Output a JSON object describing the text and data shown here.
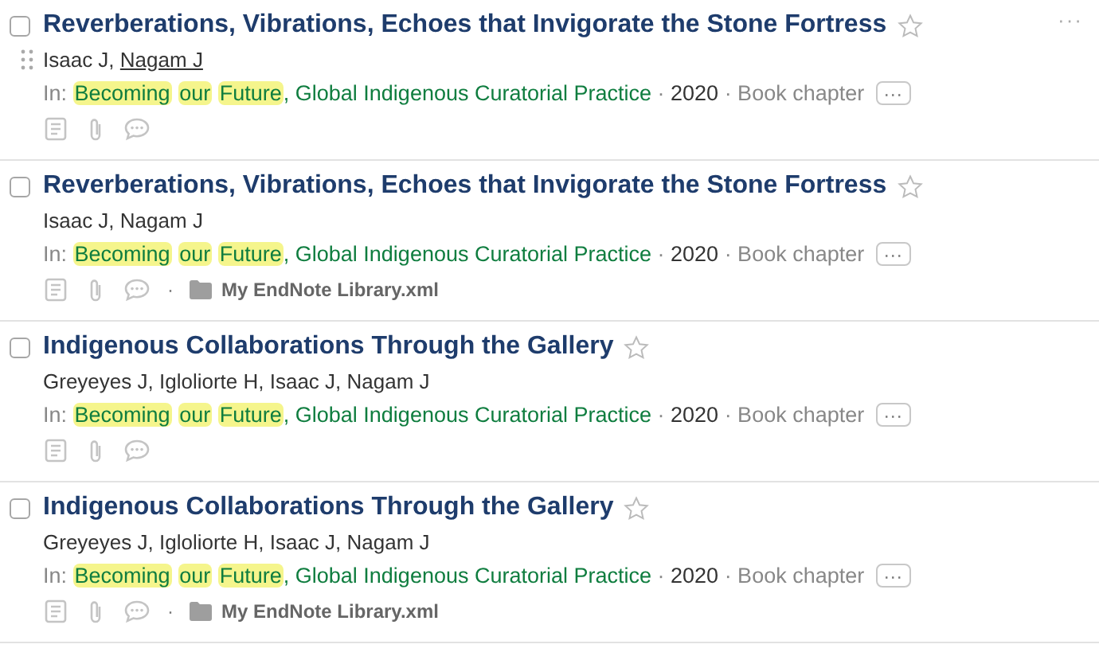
{
  "references": [
    {
      "title": "Reverberations, Vibrations, Echoes that Invigorate the Stone Fortress",
      "hovered": true,
      "checked": false,
      "starred": false,
      "authors": [
        {
          "name": "Isaac J,",
          "underlined": false
        },
        {
          "name": "Nagam J",
          "underlined": true
        }
      ],
      "prefix": "In:",
      "source": [
        {
          "text": "Becoming",
          "highlight": true
        },
        {
          "text": "our",
          "highlight": true
        },
        {
          "text": "Future",
          "highlight": true
        },
        {
          "text": ", Global Indigenous Curatorial Practice",
          "highlight": false
        }
      ],
      "dot": "·",
      "year": "2020",
      "type": "Book chapter",
      "more_label": "···",
      "row_menu": "···"
    },
    {
      "title": "Reverberations, Vibrations, Echoes that Invigorate the Stone Fortress",
      "hovered": false,
      "checked": false,
      "starred": false,
      "authors": [
        {
          "name": "Isaac J,",
          "underlined": false
        },
        {
          "name": "Nagam J",
          "underlined": false
        }
      ],
      "prefix": "In:",
      "source": [
        {
          "text": "Becoming",
          "highlight": true
        },
        {
          "text": "our",
          "highlight": true
        },
        {
          "text": "Future",
          "highlight": true
        },
        {
          "text": ", Global Indigenous Curatorial Practice",
          "highlight": false
        }
      ],
      "dot": "·",
      "year": "2020",
      "type": "Book chapter",
      "more_label": "···",
      "library": "My EndNote Library.xml"
    },
    {
      "title": "Indigenous Collaborations Through the Gallery",
      "hovered": false,
      "checked": false,
      "starred": false,
      "authors": [
        {
          "name": "Greyeyes J,",
          "underlined": false
        },
        {
          "name": "Igloliorte H,",
          "underlined": false
        },
        {
          "name": "Isaac J,",
          "underlined": false
        },
        {
          "name": "Nagam J",
          "underlined": false
        }
      ],
      "prefix": "In:",
      "source": [
        {
          "text": "Becoming",
          "highlight": true
        },
        {
          "text": "our",
          "highlight": true
        },
        {
          "text": "Future",
          "highlight": true
        },
        {
          "text": ", Global Indigenous Curatorial Practice",
          "highlight": false
        }
      ],
      "dot": "·",
      "year": "2020",
      "type": "Book chapter",
      "more_label": "···"
    },
    {
      "title": "Indigenous Collaborations Through the Gallery",
      "hovered": false,
      "checked": false,
      "starred": false,
      "authors": [
        {
          "name": "Greyeyes J,",
          "underlined": false
        },
        {
          "name": "Igloliorte H,",
          "underlined": false
        },
        {
          "name": "Isaac J,",
          "underlined": false
        },
        {
          "name": "Nagam J",
          "underlined": false
        }
      ],
      "prefix": "In:",
      "source": [
        {
          "text": "Becoming",
          "highlight": true
        },
        {
          "text": "our",
          "highlight": true
        },
        {
          "text": "Future",
          "highlight": true
        },
        {
          "text": ", Global Indigenous Curatorial Practice",
          "highlight": false
        }
      ],
      "dot": "·",
      "year": "2020",
      "type": "Book chapter",
      "more_label": "···",
      "library": "My EndNote Library.xml"
    }
  ]
}
